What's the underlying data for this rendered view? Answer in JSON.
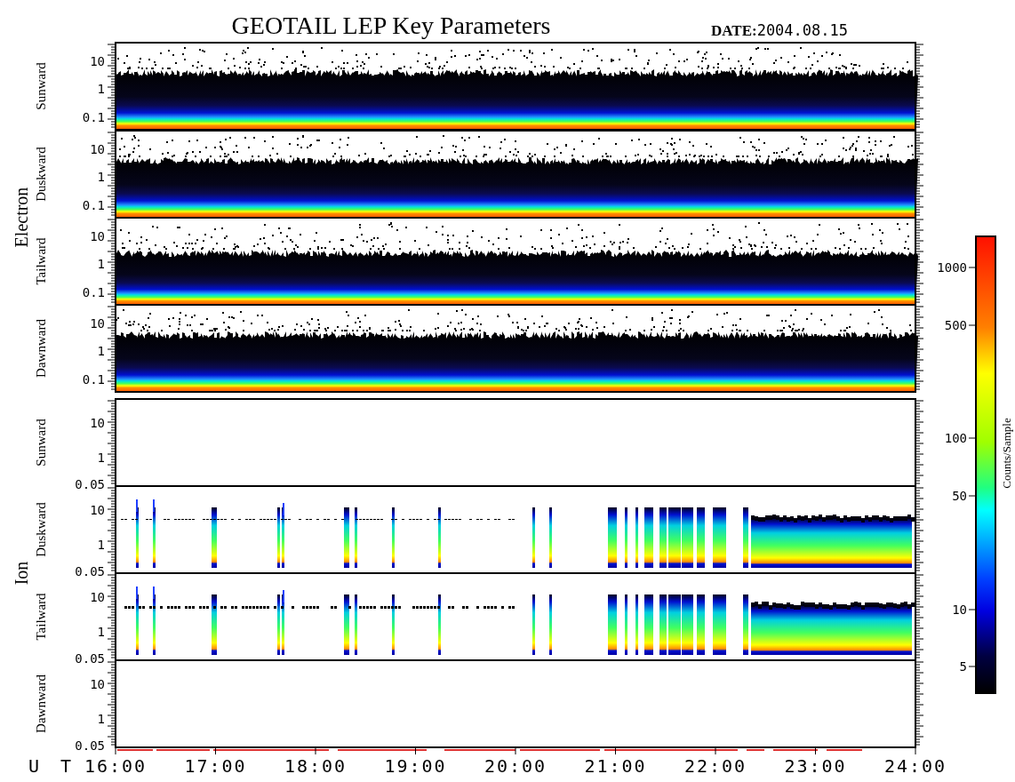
{
  "title": "GEOTAIL LEP Key Parameters",
  "date": {
    "label": "DATE:",
    "value": "2004.08.15"
  },
  "groups": [
    {
      "species": "Electron",
      "panels": [
        {
          "direction": "Sunward",
          "kind": "full",
          "yticks": [
            "10",
            "1",
            "0.1"
          ]
        },
        {
          "direction": "Duskward",
          "kind": "full",
          "yticks": [
            "10",
            "1",
            "0.1"
          ]
        },
        {
          "direction": "Tailward",
          "kind": "full",
          "yticks": [
            "10",
            "1",
            "0.1"
          ]
        },
        {
          "direction": "Dawnward",
          "kind": "full",
          "yticks": [
            "10",
            "1",
            "0.1"
          ]
        }
      ]
    },
    {
      "species": "Ion",
      "panels": [
        {
          "direction": "Sunward",
          "kind": "empty",
          "yticks": [
            "10",
            "1",
            "0.05"
          ]
        },
        {
          "direction": "Duskward",
          "kind": "bursty",
          "yticks": [
            "10",
            "1",
            "0.05"
          ]
        },
        {
          "direction": "Tailward",
          "kind": "bursty",
          "yticks": [
            "10",
            "1",
            "0.05"
          ]
        },
        {
          "direction": "Dawnward",
          "kind": "empty",
          "yticks": [
            "10",
            "1",
            "0.05"
          ]
        }
      ]
    }
  ],
  "time_axis": {
    "label": "U T",
    "ticks": [
      "16:00",
      "17:00",
      "18:00",
      "19:00",
      "20:00",
      "21:00",
      "22:00",
      "23:00",
      "24:00"
    ]
  },
  "colorbar": {
    "title": "Counts/Sample",
    "ticks": [
      "1000",
      "500",
      "100",
      "50",
      "10",
      "5"
    ]
  }
}
